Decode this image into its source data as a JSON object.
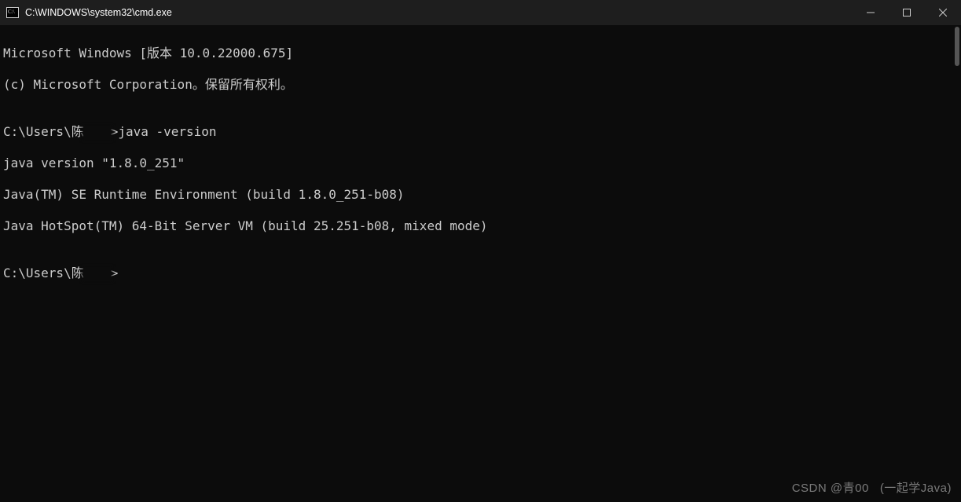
{
  "window": {
    "title": "C:\\WINDOWS\\system32\\cmd.exe"
  },
  "terminal": {
    "lines": [
      "Microsoft Windows [版本 10.0.22000.675]",
      "(c) Microsoft Corporation。保留所有权利。",
      "",
      "C:\\Users\\陈",
      ">java -version",
      "java version \"1.8.0_251\"",
      "Java(TM) SE Runtime Environment (build 1.8.0_251-b08)",
      "Java HotSpot(TM) 64-Bit Server VM (build 25.251-b08, mixed mode)",
      "",
      "C:\\Users\\陈",
      ">"
    ]
  },
  "watermark": {
    "left": "CSDN @青00",
    "right": "(一起学Java)"
  }
}
